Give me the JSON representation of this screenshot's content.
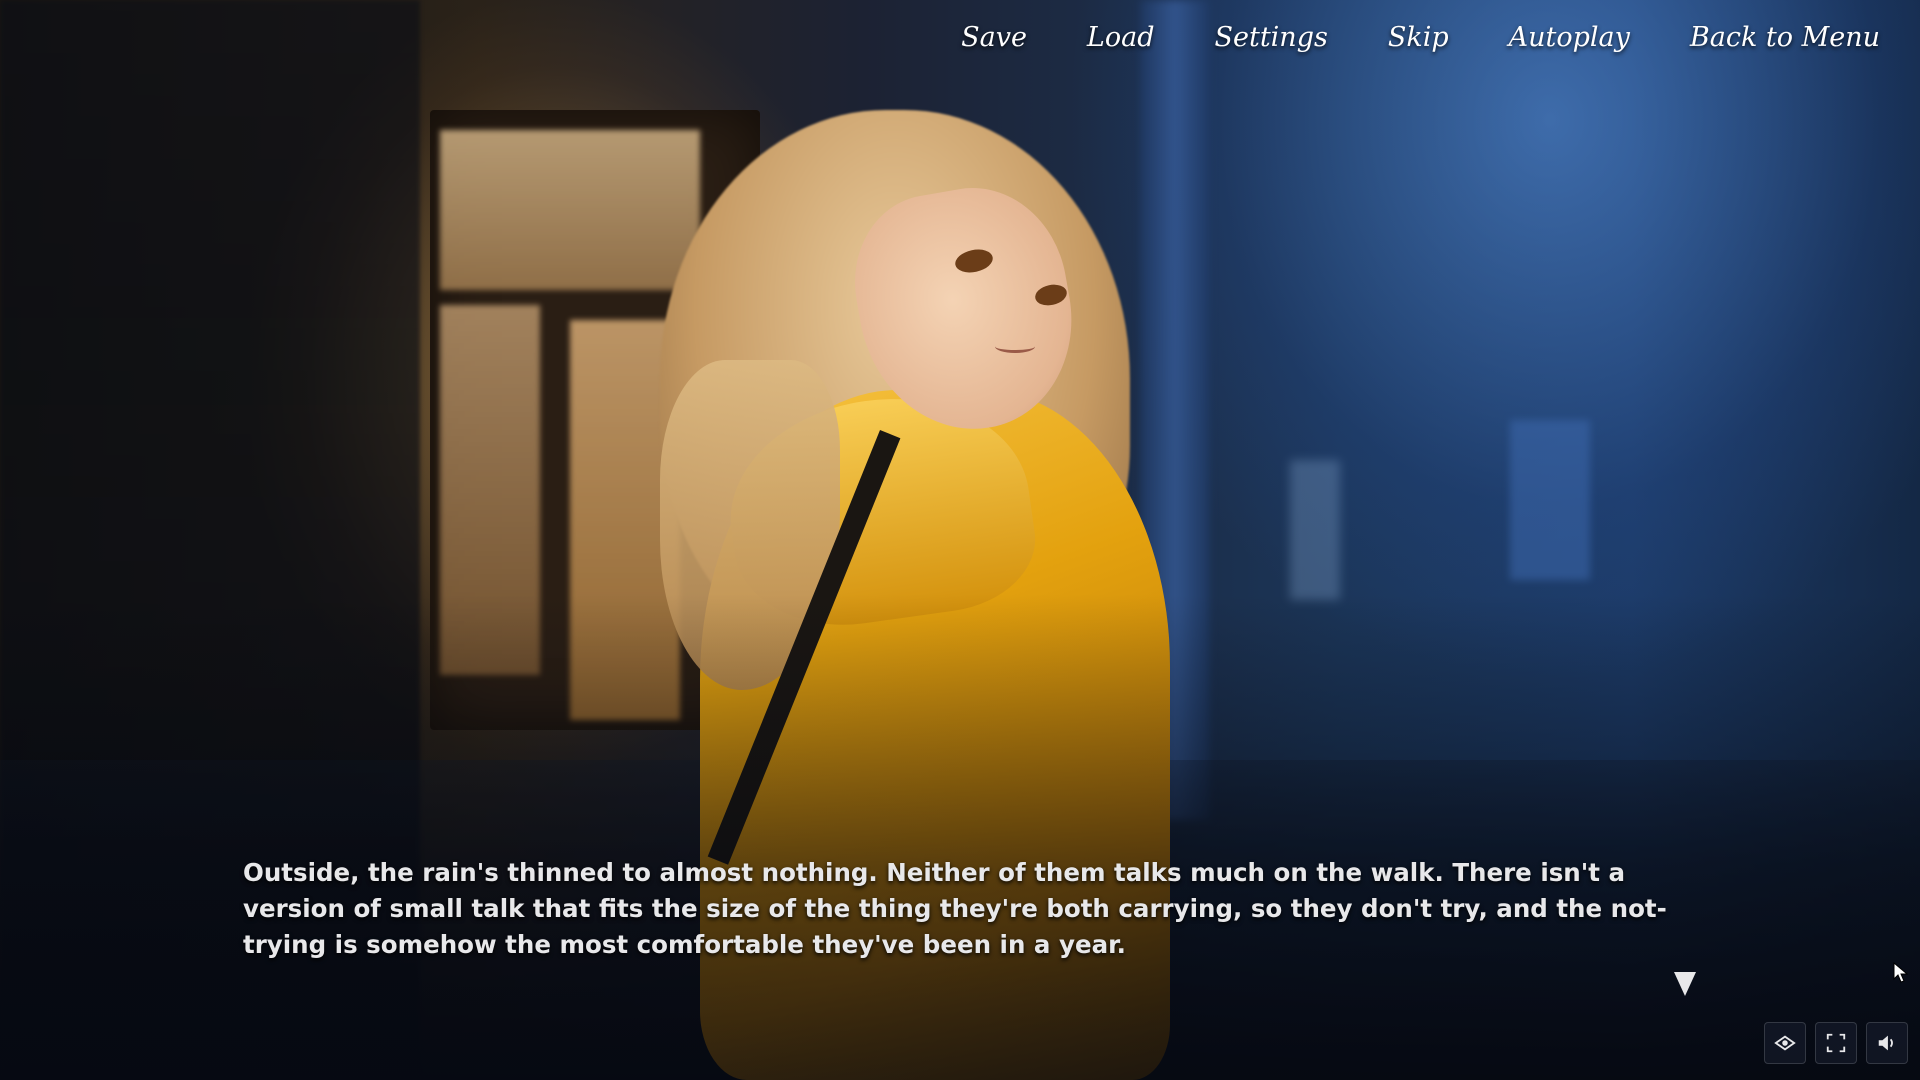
{
  "menu": {
    "items": [
      {
        "label": "Save"
      },
      {
        "label": "Load"
      },
      {
        "label": "Settings"
      },
      {
        "label": "Skip"
      },
      {
        "label": "Autoplay"
      },
      {
        "label": "Back to Menu"
      }
    ]
  },
  "dialogue": {
    "text": "Outside, the rain's thinned to almost nothing. Neither of them talks much on the walk. There isn't a version of small talk that fits the size of the thing they're both carrying, so they don't try, and the not-trying is somehow the most comfortable they've been in a year."
  },
  "controls": {
    "buttons": [
      {
        "icon": "eye-icon"
      },
      {
        "icon": "fullscreen-icon"
      },
      {
        "icon": "volume-icon"
      }
    ]
  },
  "colors": {
    "menu_text": "#ffffff",
    "dialogue_text": "#e8e8ea",
    "coat": "#e3a10e"
  }
}
